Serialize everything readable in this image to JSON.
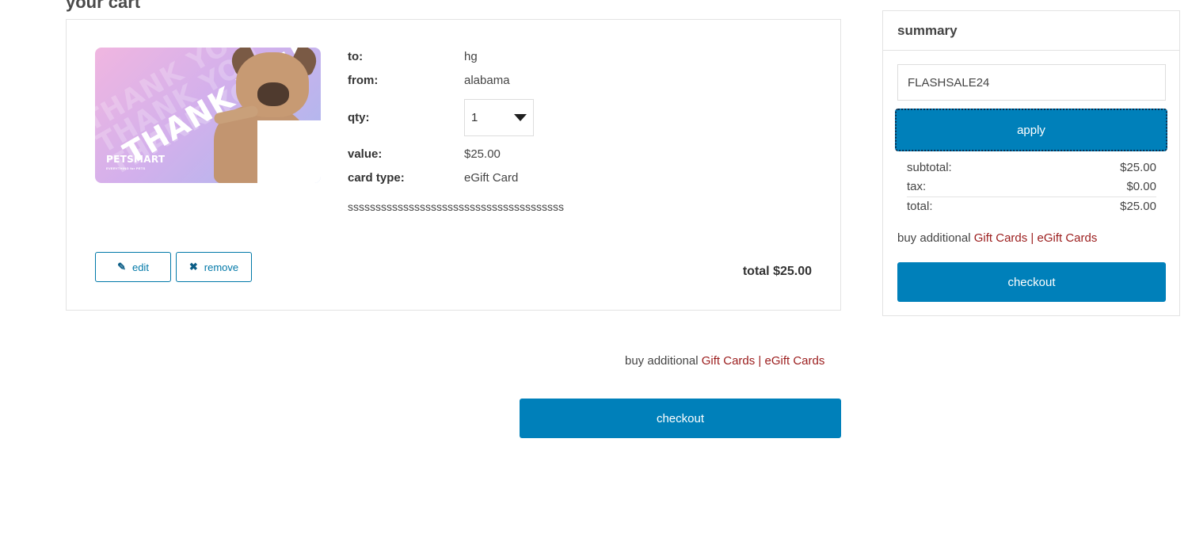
{
  "page": {
    "title": "your cart"
  },
  "item": {
    "card_art": {
      "headline": "THANK YOU",
      "watermark_lines": [
        "THANK YOU",
        "THANK YOU",
        "THANK YOU"
      ],
      "logo": "PETSMART",
      "tagline": "EVERYTHING for PETS"
    },
    "to_label": "to:",
    "to_value": "hg",
    "from_label": "from:",
    "from_value": "alabama",
    "qty_label": "qty:",
    "qty_value": "1",
    "value_label": "value:",
    "value_value": "$25.00",
    "card_type_label": "card type:",
    "card_type_value": "eGift Card",
    "message": "sssssssssssssssssssssssssssssssssssssss",
    "edit_label": "edit",
    "remove_label": "remove",
    "total_text": "total $25.00"
  },
  "buy_additional": {
    "prefix": "buy additional ",
    "gift_cards": "Gift Cards",
    "separator": " | ",
    "egift_cards": "eGift Cards"
  },
  "checkout_label": "checkout",
  "summary": {
    "title": "summary",
    "promo_code": "FLASHSALE24",
    "apply_label": "apply",
    "subtotal_label": "subtotal:",
    "subtotal_value": "$25.00",
    "tax_label": "tax:",
    "tax_value": "$0.00",
    "total_label": "total:",
    "total_value": "$25.00",
    "checkout_label": "checkout"
  },
  "colors": {
    "primary": "#0080ba",
    "link": "#9b1c1c",
    "border": "#e3e3e3"
  },
  "icons": {
    "edit": "pencil-icon",
    "remove": "x-icon",
    "qty": "caret-down-icon"
  }
}
